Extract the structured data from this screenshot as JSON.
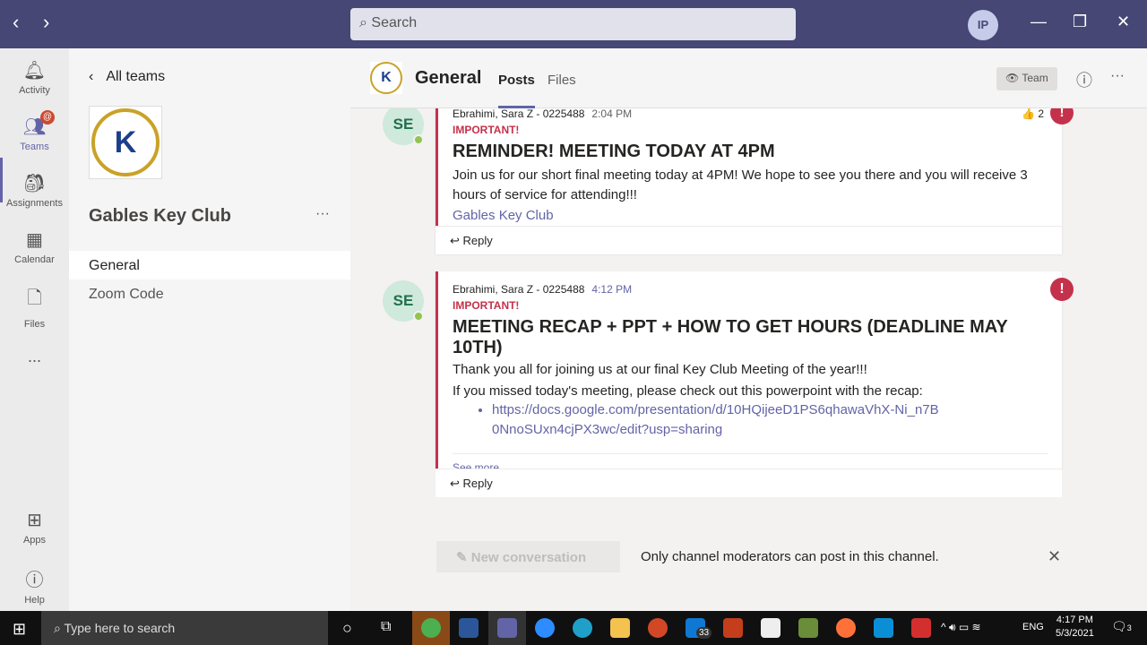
{
  "titlebar": {
    "search_placeholder": "Search",
    "avatar": "IP"
  },
  "rail": [
    {
      "label": "Activity",
      "icon": "bell-icon"
    },
    {
      "label": "Teams",
      "icon": "teams-icon",
      "badge": "@"
    },
    {
      "label": "Assignments",
      "icon": "backpack-icon"
    },
    {
      "label": "Calendar",
      "icon": "calendar-icon"
    },
    {
      "label": "Files",
      "icon": "file-icon"
    },
    {
      "label": "...",
      "icon": "more-icon"
    },
    {
      "label": "Apps",
      "icon": "apps-icon"
    },
    {
      "label": "Help",
      "icon": "help-icon"
    }
  ],
  "panel": {
    "back": "All teams",
    "team_name": "Gables Key Club",
    "more": "···",
    "channels": [
      "General",
      "Zoom Code"
    ],
    "logo_text": "K"
  },
  "header": {
    "channel": "General",
    "tabs": [
      "Posts",
      "Files"
    ],
    "team_button": "Team"
  },
  "posts": [
    {
      "initials": "SE",
      "author": "Ebrahimi, Sara Z - 0225488",
      "time": "2:04 PM",
      "importance": "IMPORTANT!",
      "subject": "REMINDER! MEETING TODAY AT 4PM",
      "body": "Join us for our short final meeting today at 4PM! We hope to see you there and you will receive 3 hours of service for attending!!!",
      "signature": "Gables Key Club",
      "reaction_count": "2",
      "reply": "Reply"
    },
    {
      "initials": "SE",
      "author": "Ebrahimi, Sara Z - 0225488",
      "time": "4:12 PM",
      "importance": "IMPORTANT!",
      "subject": "MEETING RECAP + PPT + HOW TO GET HOURS (DEADLINE MAY 10TH)",
      "line1": "Thank you all for joining us at our final Key Club Meeting of the year!!!",
      "line2": "If you missed today's meeting, please check out this powerpoint with the recap:",
      "link": "https://docs.google.com/presentation/d/10HQijeeD1PS6qhawaVhX-Ni_n7B0NnoSUxn4cjPX3wc/edit?usp=sharing",
      "see_more": "See more",
      "reply": "Reply"
    }
  ],
  "compose": {
    "new_conversation": "New conversation",
    "notice": "Only channel moderators can post in this channel."
  },
  "taskbar": {
    "search_placeholder": "Type here to search",
    "mail_badge": "33",
    "time": "4:17 PM",
    "date": "5/3/2021",
    "lang": "ENG",
    "notif_count": "3"
  }
}
